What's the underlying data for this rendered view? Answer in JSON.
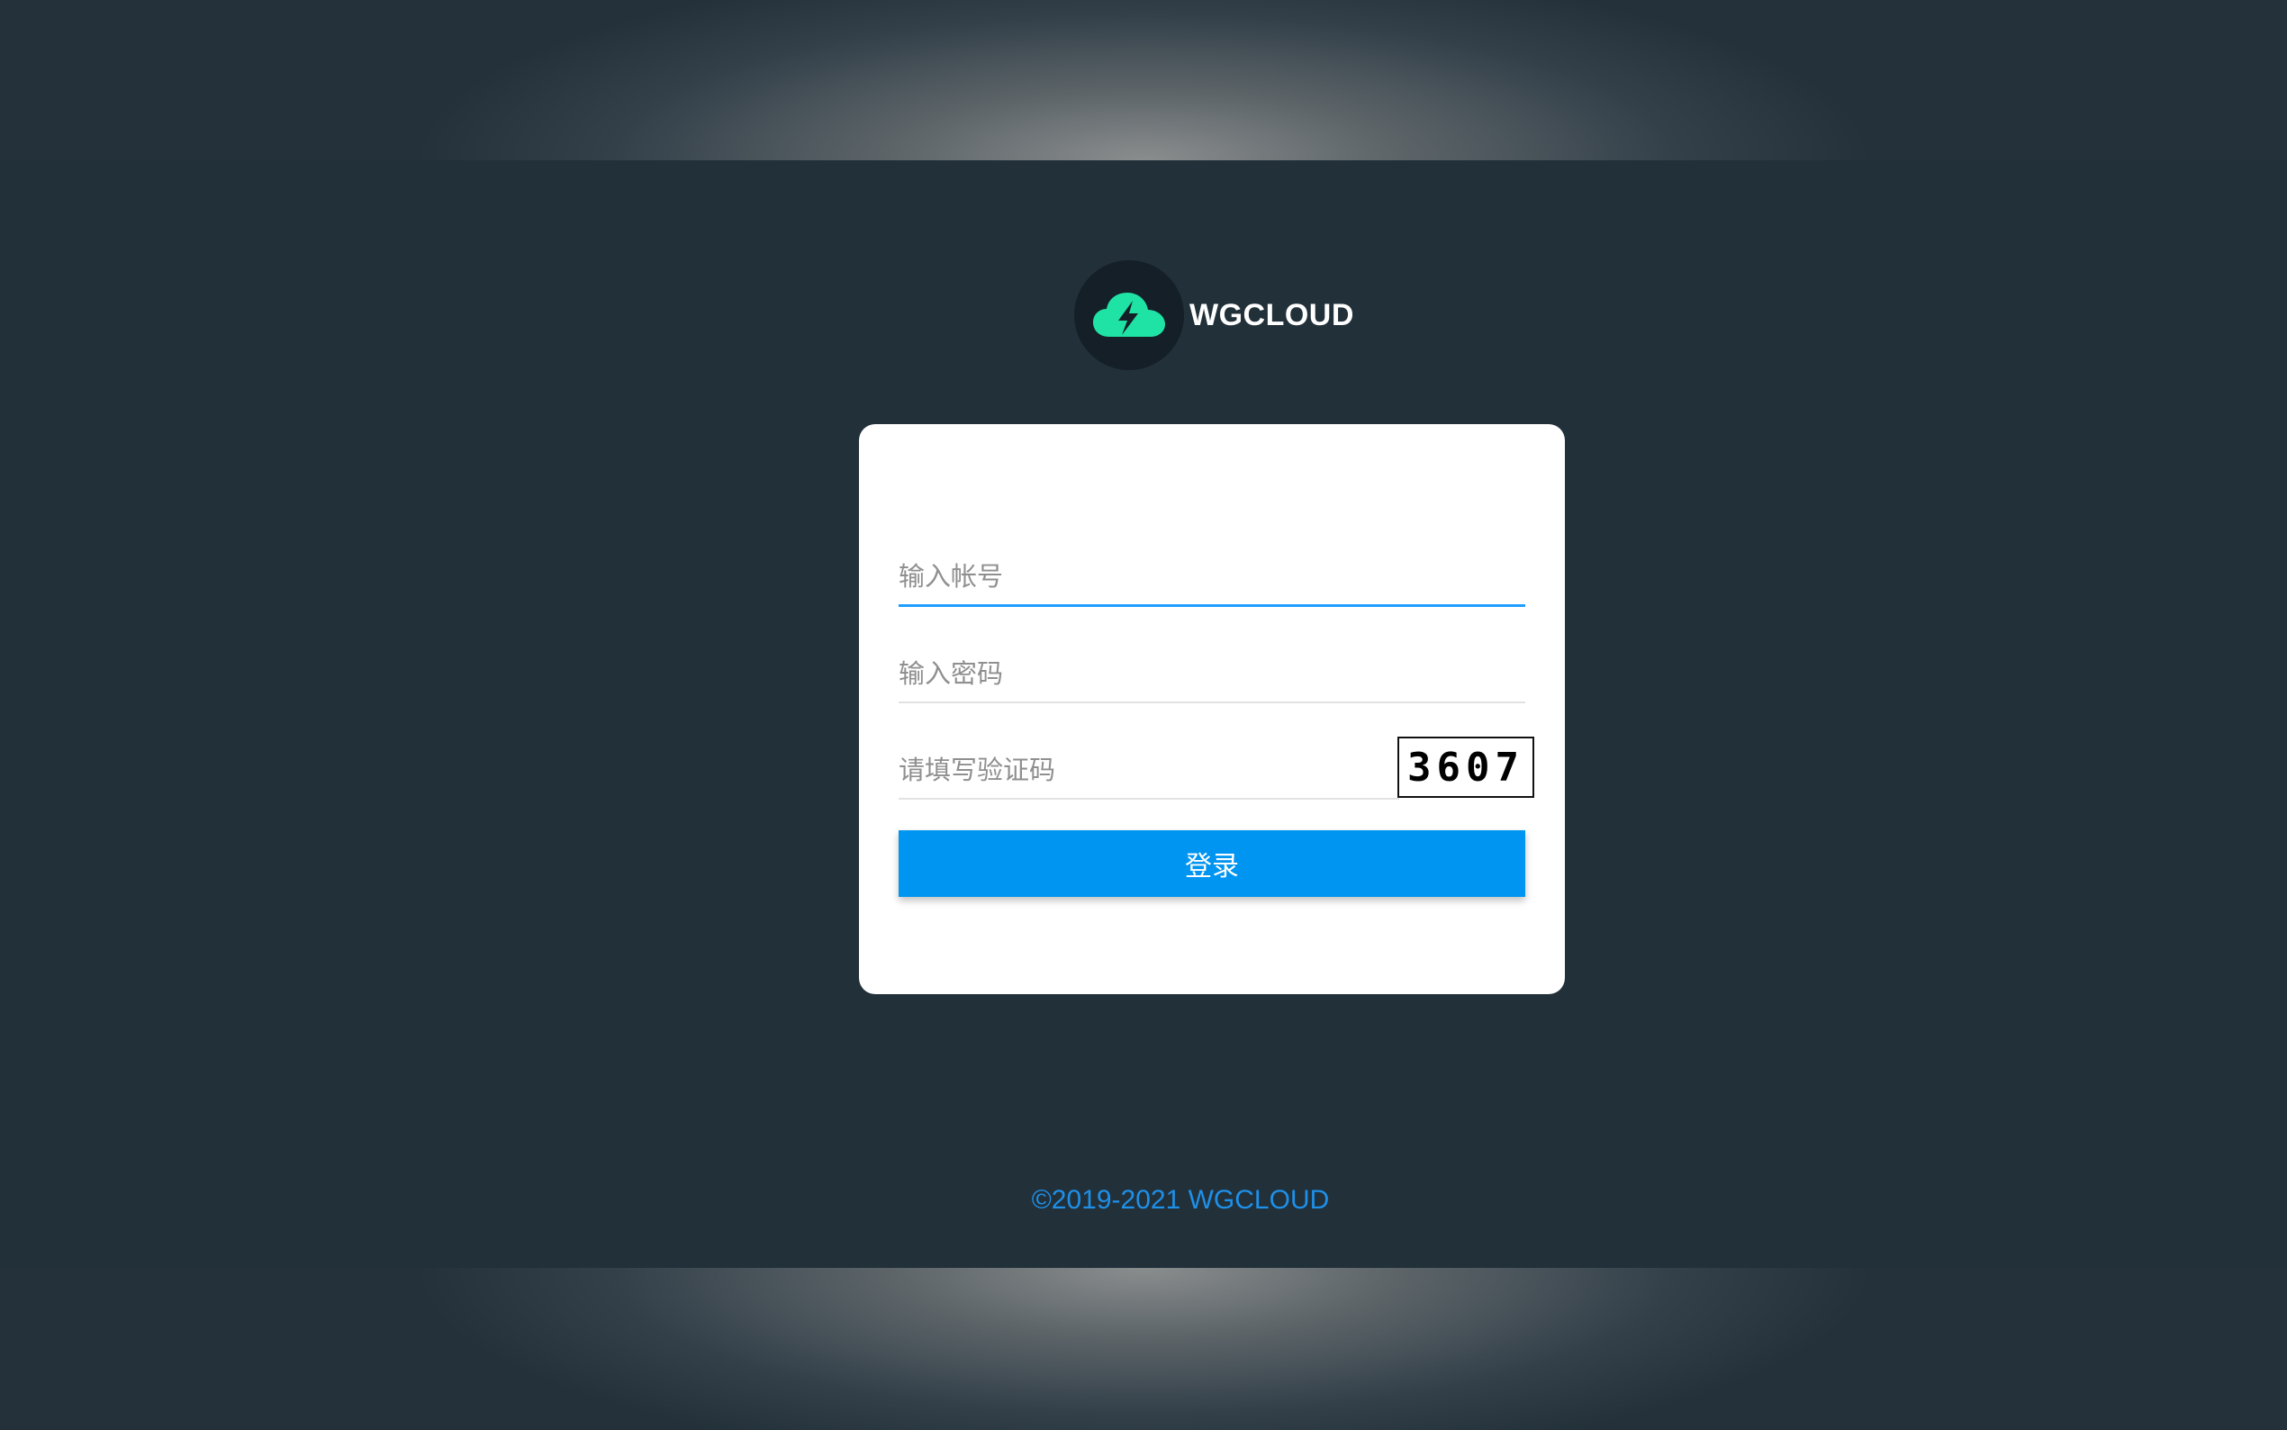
{
  "brand": {
    "name": "WGCLOUD",
    "logo_icon": "cloud-lightning-icon",
    "logo_color": "#1fe3a4"
  },
  "form": {
    "username_placeholder": "输入帐号",
    "password_placeholder": "输入密码",
    "captcha_placeholder": "请填写验证码",
    "captcha_code": "3607",
    "submit_label": "登录"
  },
  "footer": {
    "copyright": "©2019-2021 WGCLOUD"
  },
  "colors": {
    "background": "#22303a",
    "accent": "#0095f0",
    "footer_text": "#1e90e8"
  }
}
